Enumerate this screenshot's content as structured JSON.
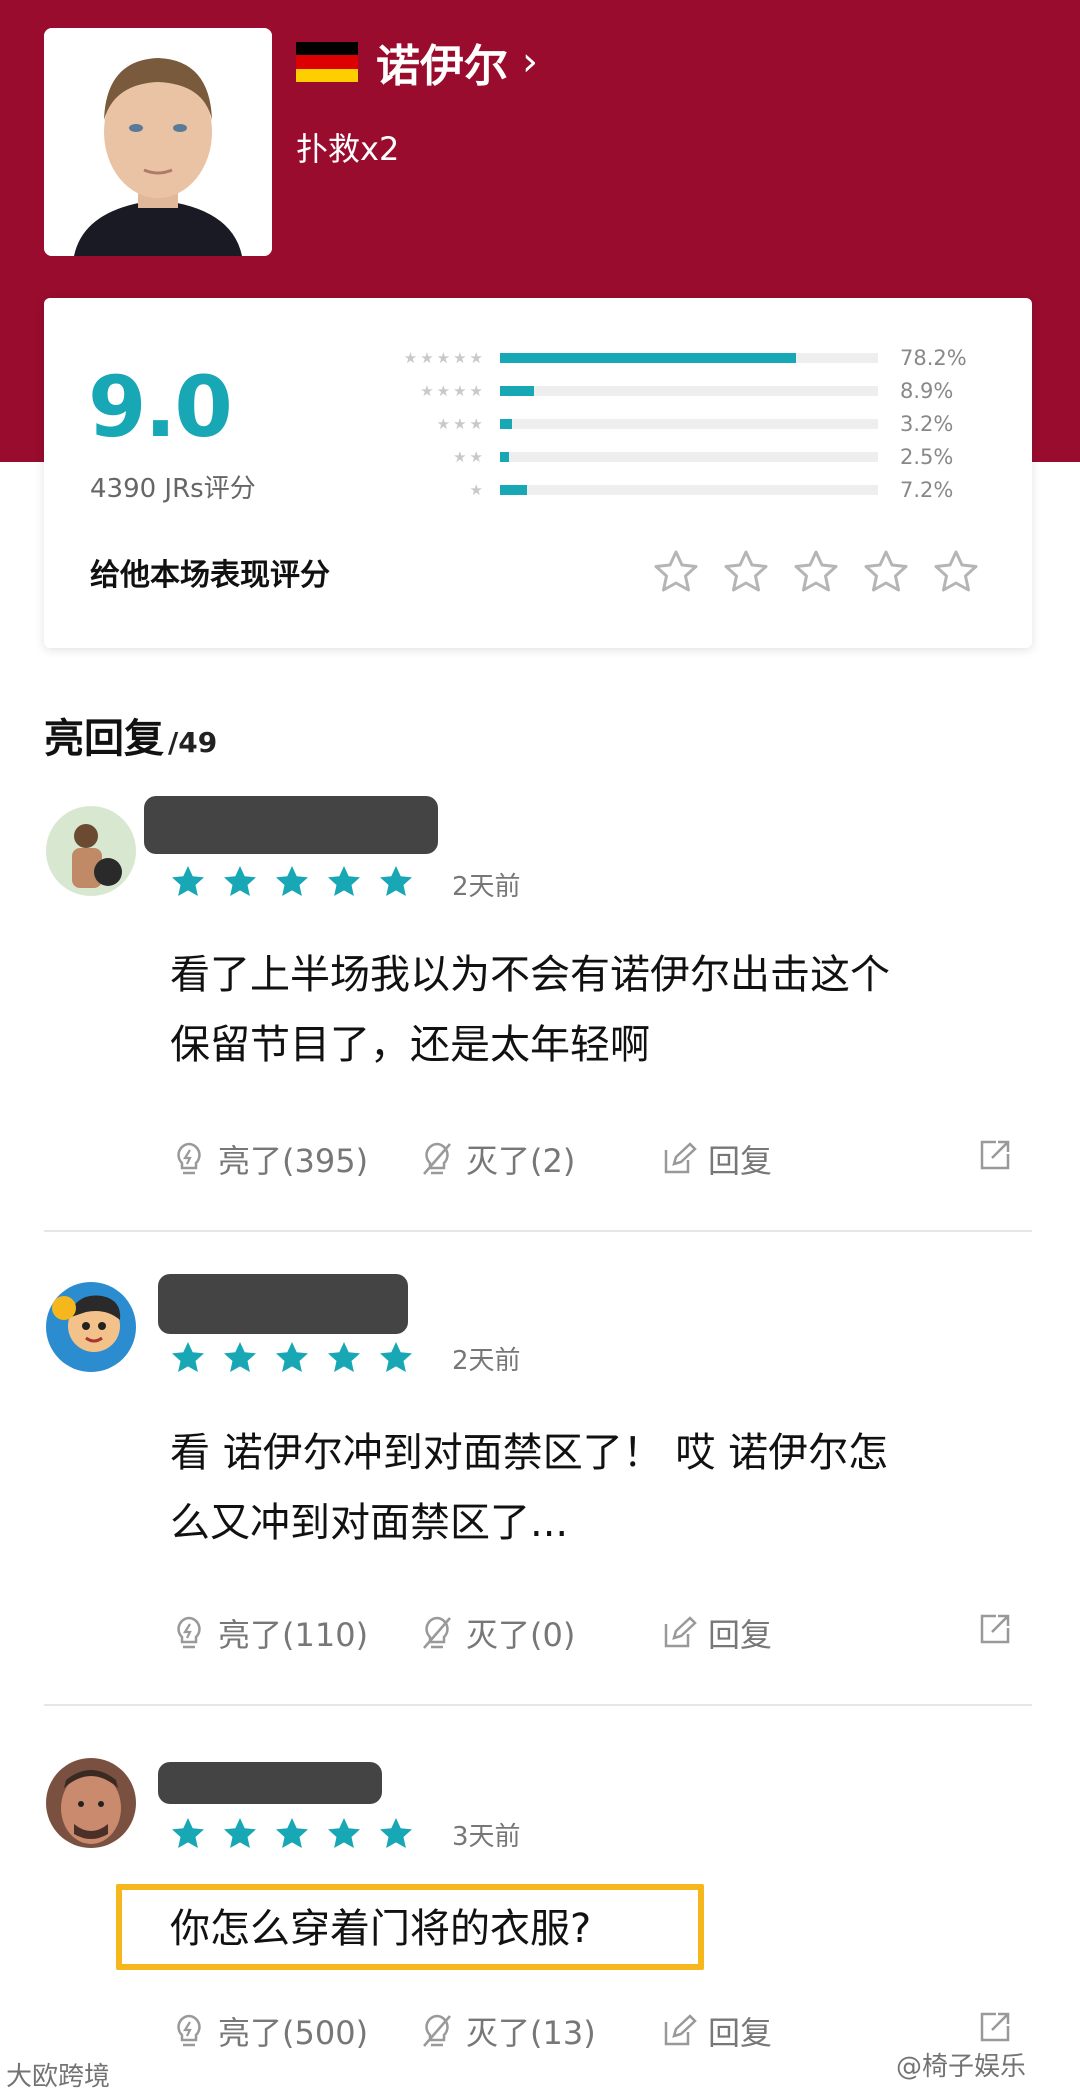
{
  "player": {
    "name": "诺伊尔",
    "stat": "扑救x2",
    "flag_colors": [
      "#000000",
      "#dd0000",
      "#ffce00"
    ]
  },
  "rating": {
    "score": "9.0",
    "count_text": "4390 JRs评分",
    "prompt": "给他本场表现评分",
    "distribution": [
      {
        "stars": 5,
        "percent_label": "78.2%",
        "value": 78.2
      },
      {
        "stars": 4,
        "percent_label": "8.9%",
        "value": 8.9
      },
      {
        "stars": 3,
        "percent_label": "3.2%",
        "value": 3.2
      },
      {
        "stars": 2,
        "percent_label": "2.5%",
        "value": 2.5
      },
      {
        "stars": 1,
        "percent_label": "7.2%",
        "value": 7.2
      }
    ]
  },
  "section": {
    "title": "亮回复",
    "count": "/49"
  },
  "comments": [
    {
      "rating": 5,
      "time": "2天前",
      "body_lines": [
        "看了上半场我以为不会有诺伊尔出击这个",
        "保留节目了，还是太年轻啊"
      ],
      "light": "亮了(395)",
      "dislike": "灭了(2)",
      "reply": "回复"
    },
    {
      "rating": 5,
      "time": "2天前",
      "body_lines": [
        "看 诺伊尔冲到对面禁区了！ 哎 诺伊尔怎",
        "么又冲到对面禁区了..."
      ],
      "light": "亮了(110)",
      "dislike": "灭了(0)",
      "reply": "回复"
    },
    {
      "rating": 5,
      "time": "3天前",
      "body_lines": [
        "你怎么穿着门将的衣服?"
      ],
      "light": "亮了(500)",
      "dislike": "灭了(13)",
      "reply": "回复"
    }
  ],
  "watermarks": {
    "left": "大欧跨境",
    "right": "@椅子娱乐"
  },
  "colors": {
    "header": "#990c2e",
    "accent": "#17a7b5",
    "highlight": "#f5b71c"
  }
}
